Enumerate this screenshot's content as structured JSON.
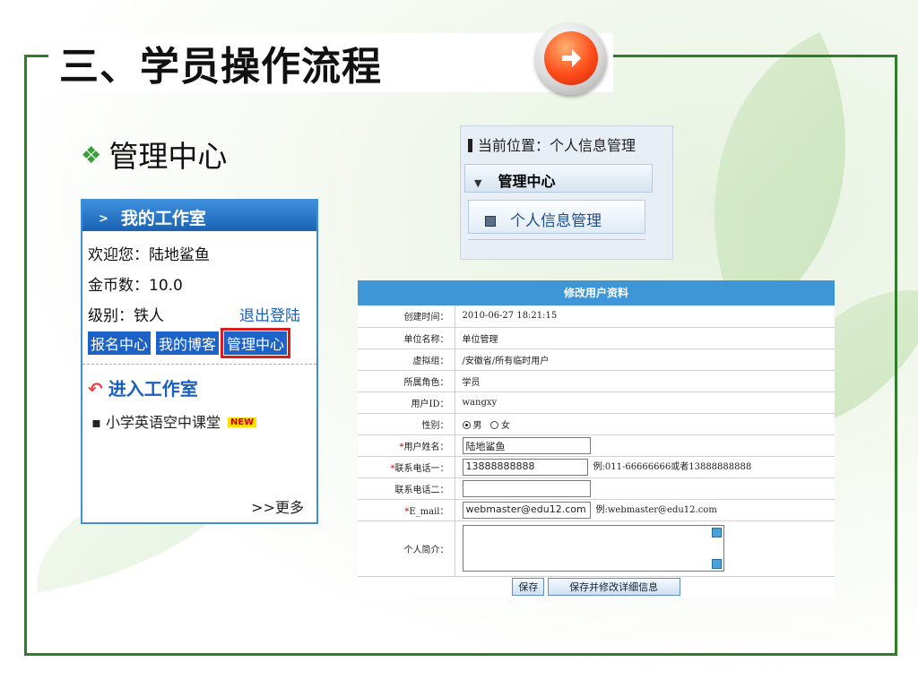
{
  "slide": {
    "title": "三、学员操作流程",
    "section": "管理中心",
    "section_bullet": "❖"
  },
  "workspace": {
    "header": "我的工作室",
    "welcome": "欢迎您：陆地鲨鱼",
    "coins": "金币数：10.0",
    "level": "级别：铁人",
    "logout": "退出登陆",
    "buttons": [
      "报名中心",
      "我的博客",
      "管理中心"
    ],
    "enter": "进入工作室",
    "course": "小学英语空中课堂",
    "new_badge": "NEW",
    "more": ">>更多"
  },
  "nav": {
    "position": "当前位置：个人信息管理",
    "group": "管理中心",
    "item": "个人信息管理"
  },
  "form": {
    "title": "修改用户资料",
    "created_label": "创建时间：",
    "created_value": "2010-06-27 18:21:15",
    "unit_label": "单位名称：",
    "unit_value": "单位管理",
    "group_label": "虚拟组：",
    "group_value": "/安徽省/所有临时用户",
    "role_label": "所属角色：",
    "role_value": "学员",
    "uid_label": "用户ID：",
    "uid_value": "wangxy",
    "gender_label": "性别：",
    "gender_male": "男",
    "gender_female": "女",
    "name_label": "用户姓名：",
    "name_value": "陆地鲨鱼",
    "phone1_label": "联系电话一：",
    "phone1_value": "13888888888",
    "phone1_example": "例:011-66666666或者13888888888",
    "phone2_label": "联系电话二：",
    "phone2_value": "",
    "email_label": "E_mail：",
    "email_value": "webmaster@edu12.com",
    "email_example": "例:webmaster@edu12.com",
    "bio_label": "个人简介：",
    "required_mark": "*",
    "save_label": "保存",
    "save_detail_label": "保存并修改详细信息"
  }
}
